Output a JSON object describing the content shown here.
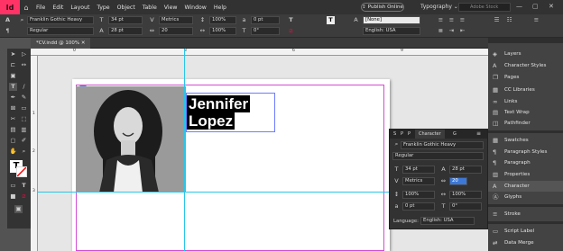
{
  "app": {
    "logo": "Id"
  },
  "menubar": {
    "items": [
      "File",
      "Edit",
      "Layout",
      "Type",
      "Object",
      "Table",
      "View",
      "Window",
      "Help"
    ],
    "publish_label": "Publish Online",
    "workspace_label": "Typography",
    "search_placeholder": "Adobe Stock"
  },
  "control": {
    "font_family": "Franklin Gothic Heavy",
    "font_style": "Regular",
    "font_size": "34 pt",
    "leading": "28 pt",
    "kerning": "Metrics",
    "tracking": "20",
    "scale_v": "100%",
    "scale_h": "100%",
    "baseline": "0 pt",
    "skew": "0°",
    "char_style": "[None]",
    "language": "English: USA"
  },
  "document": {
    "tab_label": "*CV.indd @ 100%"
  },
  "rulers": {
    "top": [
      "0",
      "3",
      "6",
      "9"
    ],
    "left": [
      "1",
      "2",
      "3"
    ]
  },
  "canvas": {
    "name_line1": "Jennifer",
    "name_line2": "Lopez"
  },
  "panels": {
    "items": [
      {
        "label": "Layers",
        "icon": "layers-icon"
      },
      {
        "label": "Character Styles",
        "icon": "char-styles-icon"
      },
      {
        "label": "Pages",
        "icon": "pages-icon"
      },
      {
        "label": "CC Libraries",
        "icon": "cc-libraries-icon"
      },
      {
        "label": "Links",
        "icon": "links-icon"
      },
      {
        "label": "Text Wrap",
        "icon": "text-wrap-icon"
      },
      {
        "label": "Pathfinder",
        "icon": "pathfinder-icon"
      },
      {
        "label": "Swatches",
        "icon": "swatches-icon"
      },
      {
        "label": "Paragraph Styles",
        "icon": "paragraph-styles-icon"
      },
      {
        "label": "Paragraph",
        "icon": "paragraph-icon"
      },
      {
        "label": "Properties",
        "icon": "properties-icon"
      },
      {
        "label": "Character",
        "icon": "character-icon"
      },
      {
        "label": "Glyphs",
        "icon": "glyphs-icon"
      },
      {
        "label": "Stroke",
        "icon": "stroke-icon"
      },
      {
        "label": "Script Label",
        "icon": "script-label-icon"
      },
      {
        "label": "Data Merge",
        "icon": "data-merge-icon"
      }
    ]
  },
  "charpanel": {
    "tabs": [
      "S",
      "P",
      "P",
      "Character",
      "G"
    ],
    "font_family": "Franklin Gothic Heavy",
    "font_style": "Regular",
    "size": "34 pt",
    "leading": "28 pt",
    "kerning": "Metrics",
    "tracking": "20",
    "scale_v": "100%",
    "scale_h": "100%",
    "baseline": "0 pt",
    "skew": "0°",
    "language_label": "Language:",
    "language": "English: USA"
  },
  "colors": {
    "accent": "#ff3366",
    "frame": "#6d7cff",
    "guide": "#29c6ea",
    "margin": "#d24cd2"
  }
}
